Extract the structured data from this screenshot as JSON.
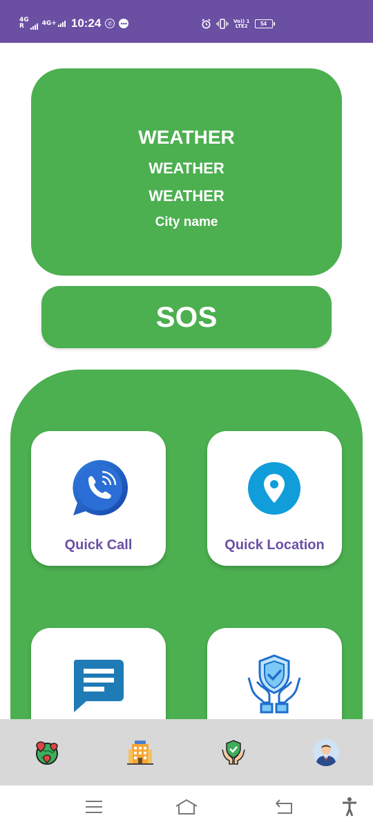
{
  "status_bar": {
    "time": "10:24",
    "sim1_network": "4G",
    "sim1_roaming": "R",
    "sim2_network": "4G+",
    "volte_top": "Vo)) 1",
    "volte_bottom": "LTE2",
    "battery_level": "54",
    "icons": [
      "whatsapp-icon",
      "message-icon",
      "alarm-icon",
      "vibrate-icon"
    ]
  },
  "weather": {
    "line1": "WEATHER",
    "line2": "WEATHER",
    "line3": "WEATHER",
    "city": "City name"
  },
  "sos": {
    "label": "SOS"
  },
  "actions": [
    {
      "label": "Quick Call",
      "icon": "phone-call-icon"
    },
    {
      "label": "Quick Location",
      "icon": "location-pin-icon"
    },
    {
      "label": "",
      "icon": "message-icon"
    },
    {
      "label": "",
      "icon": "safety-shield-hands-icon"
    }
  ],
  "bottom_nav": [
    {
      "icon": "map-globe-icon"
    },
    {
      "icon": "hotel-icon"
    },
    {
      "icon": "safety-hands-icon"
    },
    {
      "icon": "profile-avatar-icon"
    }
  ],
  "system_nav": [
    "menu-icon",
    "home-icon",
    "back-icon",
    "accessibility-icon"
  ],
  "colors": {
    "status_bar": "#6a4fa3",
    "primary_green": "#4caf50",
    "label_purple": "#6a4fa3",
    "nav_background": "#d8d8d8"
  }
}
